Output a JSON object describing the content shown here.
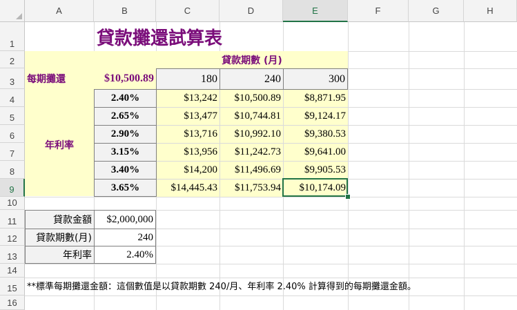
{
  "columns": [
    "A",
    "B",
    "C",
    "D",
    "E",
    "F",
    "G",
    "H"
  ],
  "rows": [
    "1",
    "2",
    "3",
    "4",
    "5",
    "6",
    "7",
    "8",
    "9",
    "10",
    "11",
    "12",
    "13",
    "14",
    "15",
    "16"
  ],
  "title": "貸款攤還試算表",
  "period_header": "貸款期數 (月)",
  "payment_label": "每期攤還",
  "payment_value": "$10,500.89",
  "periods": [
    "180",
    "240",
    "300"
  ],
  "rate_label": "年利率",
  "rates": [
    "2.40%",
    "2.65%",
    "2.90%",
    "3.15%",
    "3.40%",
    "3.65%"
  ],
  "table": [
    [
      "$13,242",
      "$10,500.89",
      "$8,871.95"
    ],
    [
      "$13,477",
      "$10,744.81",
      "$9,124.17"
    ],
    [
      "$13,716",
      "$10,992.10",
      "$9,380.53"
    ],
    [
      "$13,956",
      "$11,242.73",
      "$9,641.00"
    ],
    [
      "$14,200",
      "$11,496.69",
      "$9,905.53"
    ],
    [
      "$14,445.43",
      "$11,753.94",
      "$10,174.09"
    ]
  ],
  "inputs": [
    {
      "label": "貸款金額",
      "value": "$2,000,000"
    },
    {
      "label": "貸款期數(月)",
      "value": "240"
    },
    {
      "label": "年利率",
      "value": "2.40%"
    }
  ],
  "note": "**標準每期攤還金額：這個數值是以貸款期數 240/月、年利率 2.40% 計算得到的每期攤還金額。"
}
